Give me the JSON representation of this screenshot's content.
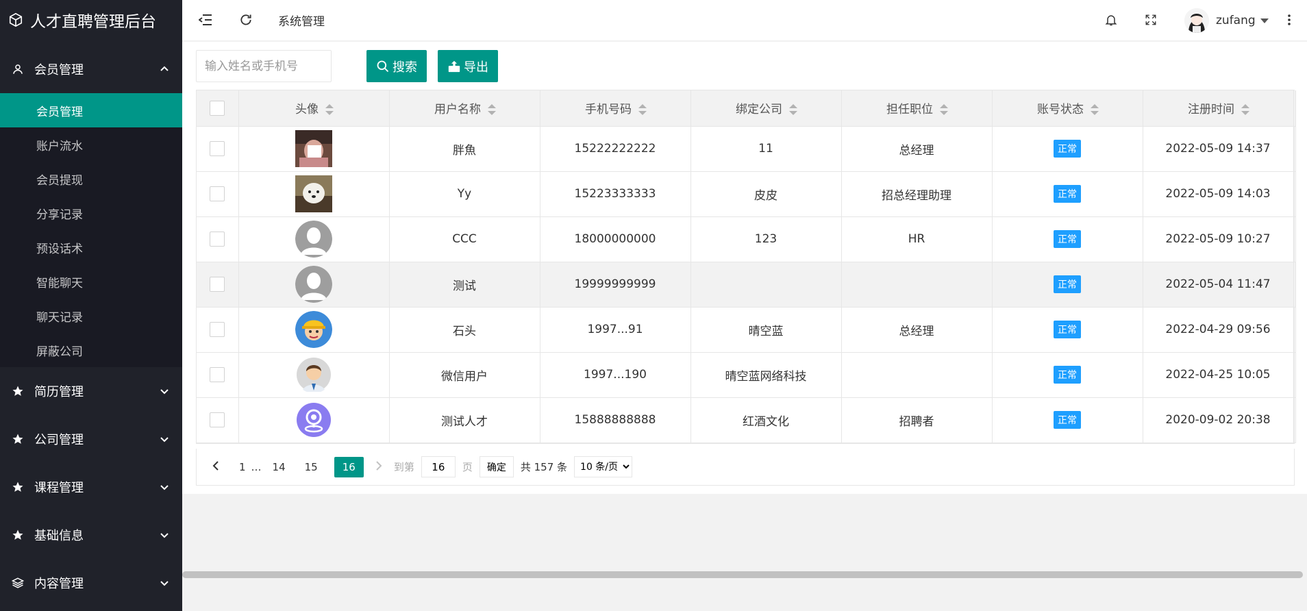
{
  "app": {
    "title": "人才直聘管理后台"
  },
  "sidebar": {
    "groups": [
      {
        "label": "会员管理",
        "icon": "user-icon",
        "expanded": true,
        "items": [
          "会员管理",
          "账户流水",
          "会员提现",
          "分享记录",
          "预设话术",
          "智能聊天",
          "聊天记录",
          "屏蔽公司"
        ]
      },
      {
        "label": "简历管理",
        "icon": "star-icon"
      },
      {
        "label": "公司管理",
        "icon": "star-icon"
      },
      {
        "label": "课程管理",
        "icon": "star-icon"
      },
      {
        "label": "基础信息",
        "icon": "star-icon"
      },
      {
        "label": "内容管理",
        "icon": "layers-icon"
      }
    ],
    "active_item": "会员管理"
  },
  "header": {
    "breadcrumb": "系统管理",
    "username": "zufang"
  },
  "toolbar": {
    "search_placeholder": "输入姓名或手机号",
    "search_label": "搜索",
    "export_label": "导出"
  },
  "table": {
    "columns": [
      "头像",
      "用户名称",
      "手机号码",
      "绑定公司",
      "担任职位",
      "账号状态",
      "注册时间"
    ],
    "rows": [
      {
        "avatar": "photo-person",
        "name": "胖魚",
        "phone": "15222222222",
        "company": "11",
        "position": "总经理",
        "status": "正常",
        "time": "2022-05-09 14:37"
      },
      {
        "avatar": "photo-dog",
        "name": "Yy",
        "phone": "15223333333",
        "company": "皮皮",
        "position": "招总经理助理",
        "status": "正常",
        "time": "2022-05-09 14:03"
      },
      {
        "avatar": "default-avatar",
        "name": "CCC",
        "phone": "18000000000",
        "company": "123",
        "position": "HR",
        "status": "正常",
        "time": "2022-05-09 10:27"
      },
      {
        "avatar": "default-avatar",
        "name": "测试",
        "phone": "19999999999",
        "company": "",
        "position": "",
        "status": "正常",
        "time": "2022-05-04 11:47"
      },
      {
        "avatar": "worker-avatar",
        "name": "石头",
        "phone": "1997...91",
        "company": "晴空蓝",
        "position": "总经理",
        "status": "正常",
        "time": "2022-04-29 09:56"
      },
      {
        "avatar": "man-avatar",
        "name": "微信用户",
        "phone": "1997...190",
        "company": "晴空蓝网络科技",
        "position": "",
        "status": "正常",
        "time": "2022-04-25 10:05"
      },
      {
        "avatar": "location-avatar",
        "name": "测试人才",
        "phone": "15888888888",
        "company": "红酒文化",
        "position": "招聘者",
        "status": "正常",
        "time": "2020-09-02 20:38"
      }
    ]
  },
  "pagination": {
    "first": "1",
    "ellipsis": "…",
    "p14": "14",
    "p15": "15",
    "current": "16",
    "goto_label": "到第",
    "goto_value": "16",
    "page_suffix": "页",
    "confirm": "确定",
    "total": "共 157 条",
    "per_page": "10 条/页"
  },
  "colors": {
    "accent": "#009688",
    "sidebar": "#20222a",
    "badge": "#1e9fff"
  }
}
